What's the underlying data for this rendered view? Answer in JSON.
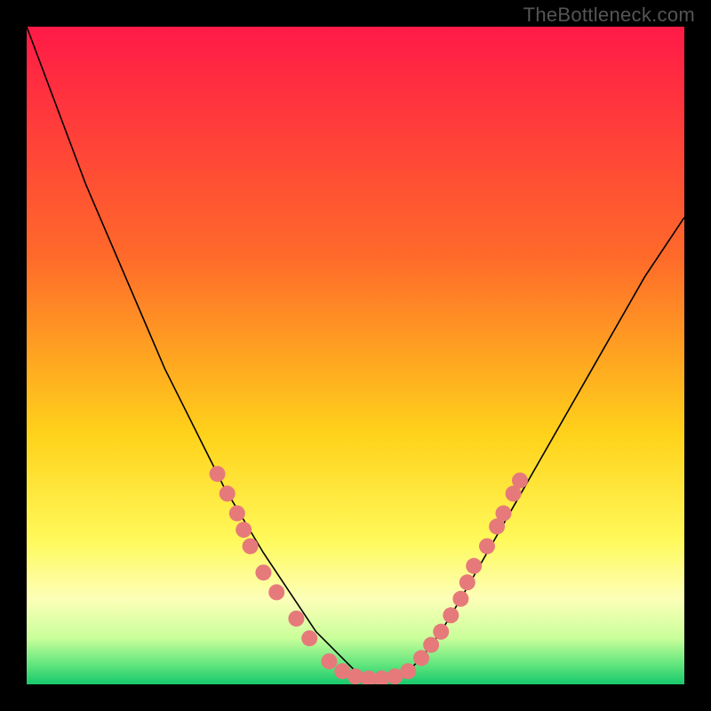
{
  "watermark": "TheBottleneck.com",
  "chart_data": {
    "type": "line",
    "title": "",
    "xlabel": "",
    "ylabel": "",
    "xlim": [
      0,
      100
    ],
    "ylim": [
      0,
      100
    ],
    "grid": false,
    "legend": false,
    "background": {
      "type": "vertical-gradient",
      "stops": [
        {
          "offset": 0.0,
          "color": "#ff1a47"
        },
        {
          "offset": 0.35,
          "color": "#ff6a2a"
        },
        {
          "offset": 0.62,
          "color": "#ffd21a"
        },
        {
          "offset": 0.78,
          "color": "#fff95a"
        },
        {
          "offset": 0.87,
          "color": "#fdffb8"
        },
        {
          "offset": 0.93,
          "color": "#c9ff9a"
        },
        {
          "offset": 0.97,
          "color": "#61e57d"
        },
        {
          "offset": 1.0,
          "color": "#17c96d"
        }
      ]
    },
    "series": [
      {
        "name": "bottleneck-curve",
        "color": "#000000",
        "width": 1.6,
        "x": [
          0,
          3,
          6,
          9,
          12,
          15,
          18,
          21,
          24,
          27,
          30,
          33,
          36,
          38,
          40,
          42,
          44,
          46,
          48,
          50,
          52,
          54,
          56,
          58,
          60,
          63,
          66,
          70,
          74,
          78,
          82,
          86,
          90,
          94,
          98,
          100
        ],
        "y": [
          100,
          92,
          84,
          76,
          69,
          62,
          55,
          48,
          42,
          36,
          30,
          25,
          20,
          17,
          14,
          11,
          8,
          6,
          4,
          2,
          1,
          0.5,
          1,
          2,
          4,
          8,
          13,
          20,
          27,
          34,
          41,
          48,
          55,
          62,
          68,
          71
        ]
      }
    ],
    "markers": [
      {
        "name": "left-cluster",
        "color": "#e67a7a",
        "radius": 9,
        "points": [
          {
            "x": 29,
            "y": 32
          },
          {
            "x": 30.5,
            "y": 29
          },
          {
            "x": 32,
            "y": 26
          },
          {
            "x": 33,
            "y": 23.5
          },
          {
            "x": 34,
            "y": 21
          },
          {
            "x": 36,
            "y": 17
          },
          {
            "x": 38,
            "y": 14
          },
          {
            "x": 41,
            "y": 10
          },
          {
            "x": 43,
            "y": 7
          }
        ]
      },
      {
        "name": "bottom-cluster",
        "color": "#e67a7a",
        "radius": 9,
        "points": [
          {
            "x": 46,
            "y": 3.5
          },
          {
            "x": 48,
            "y": 2
          },
          {
            "x": 50,
            "y": 1.2
          },
          {
            "x": 52,
            "y": 0.9
          },
          {
            "x": 54,
            "y": 0.9
          },
          {
            "x": 56,
            "y": 1.2
          },
          {
            "x": 58,
            "y": 2
          }
        ]
      },
      {
        "name": "right-cluster",
        "color": "#e67a7a",
        "radius": 9,
        "points": [
          {
            "x": 60,
            "y": 4
          },
          {
            "x": 61.5,
            "y": 6
          },
          {
            "x": 63,
            "y": 8
          },
          {
            "x": 64.5,
            "y": 10.5
          },
          {
            "x": 66,
            "y": 13
          },
          {
            "x": 67,
            "y": 15.5
          },
          {
            "x": 68,
            "y": 18
          },
          {
            "x": 70,
            "y": 21
          },
          {
            "x": 71.5,
            "y": 24
          },
          {
            "x": 72.5,
            "y": 26
          },
          {
            "x": 74,
            "y": 29
          },
          {
            "x": 75,
            "y": 31
          }
        ]
      }
    ]
  }
}
